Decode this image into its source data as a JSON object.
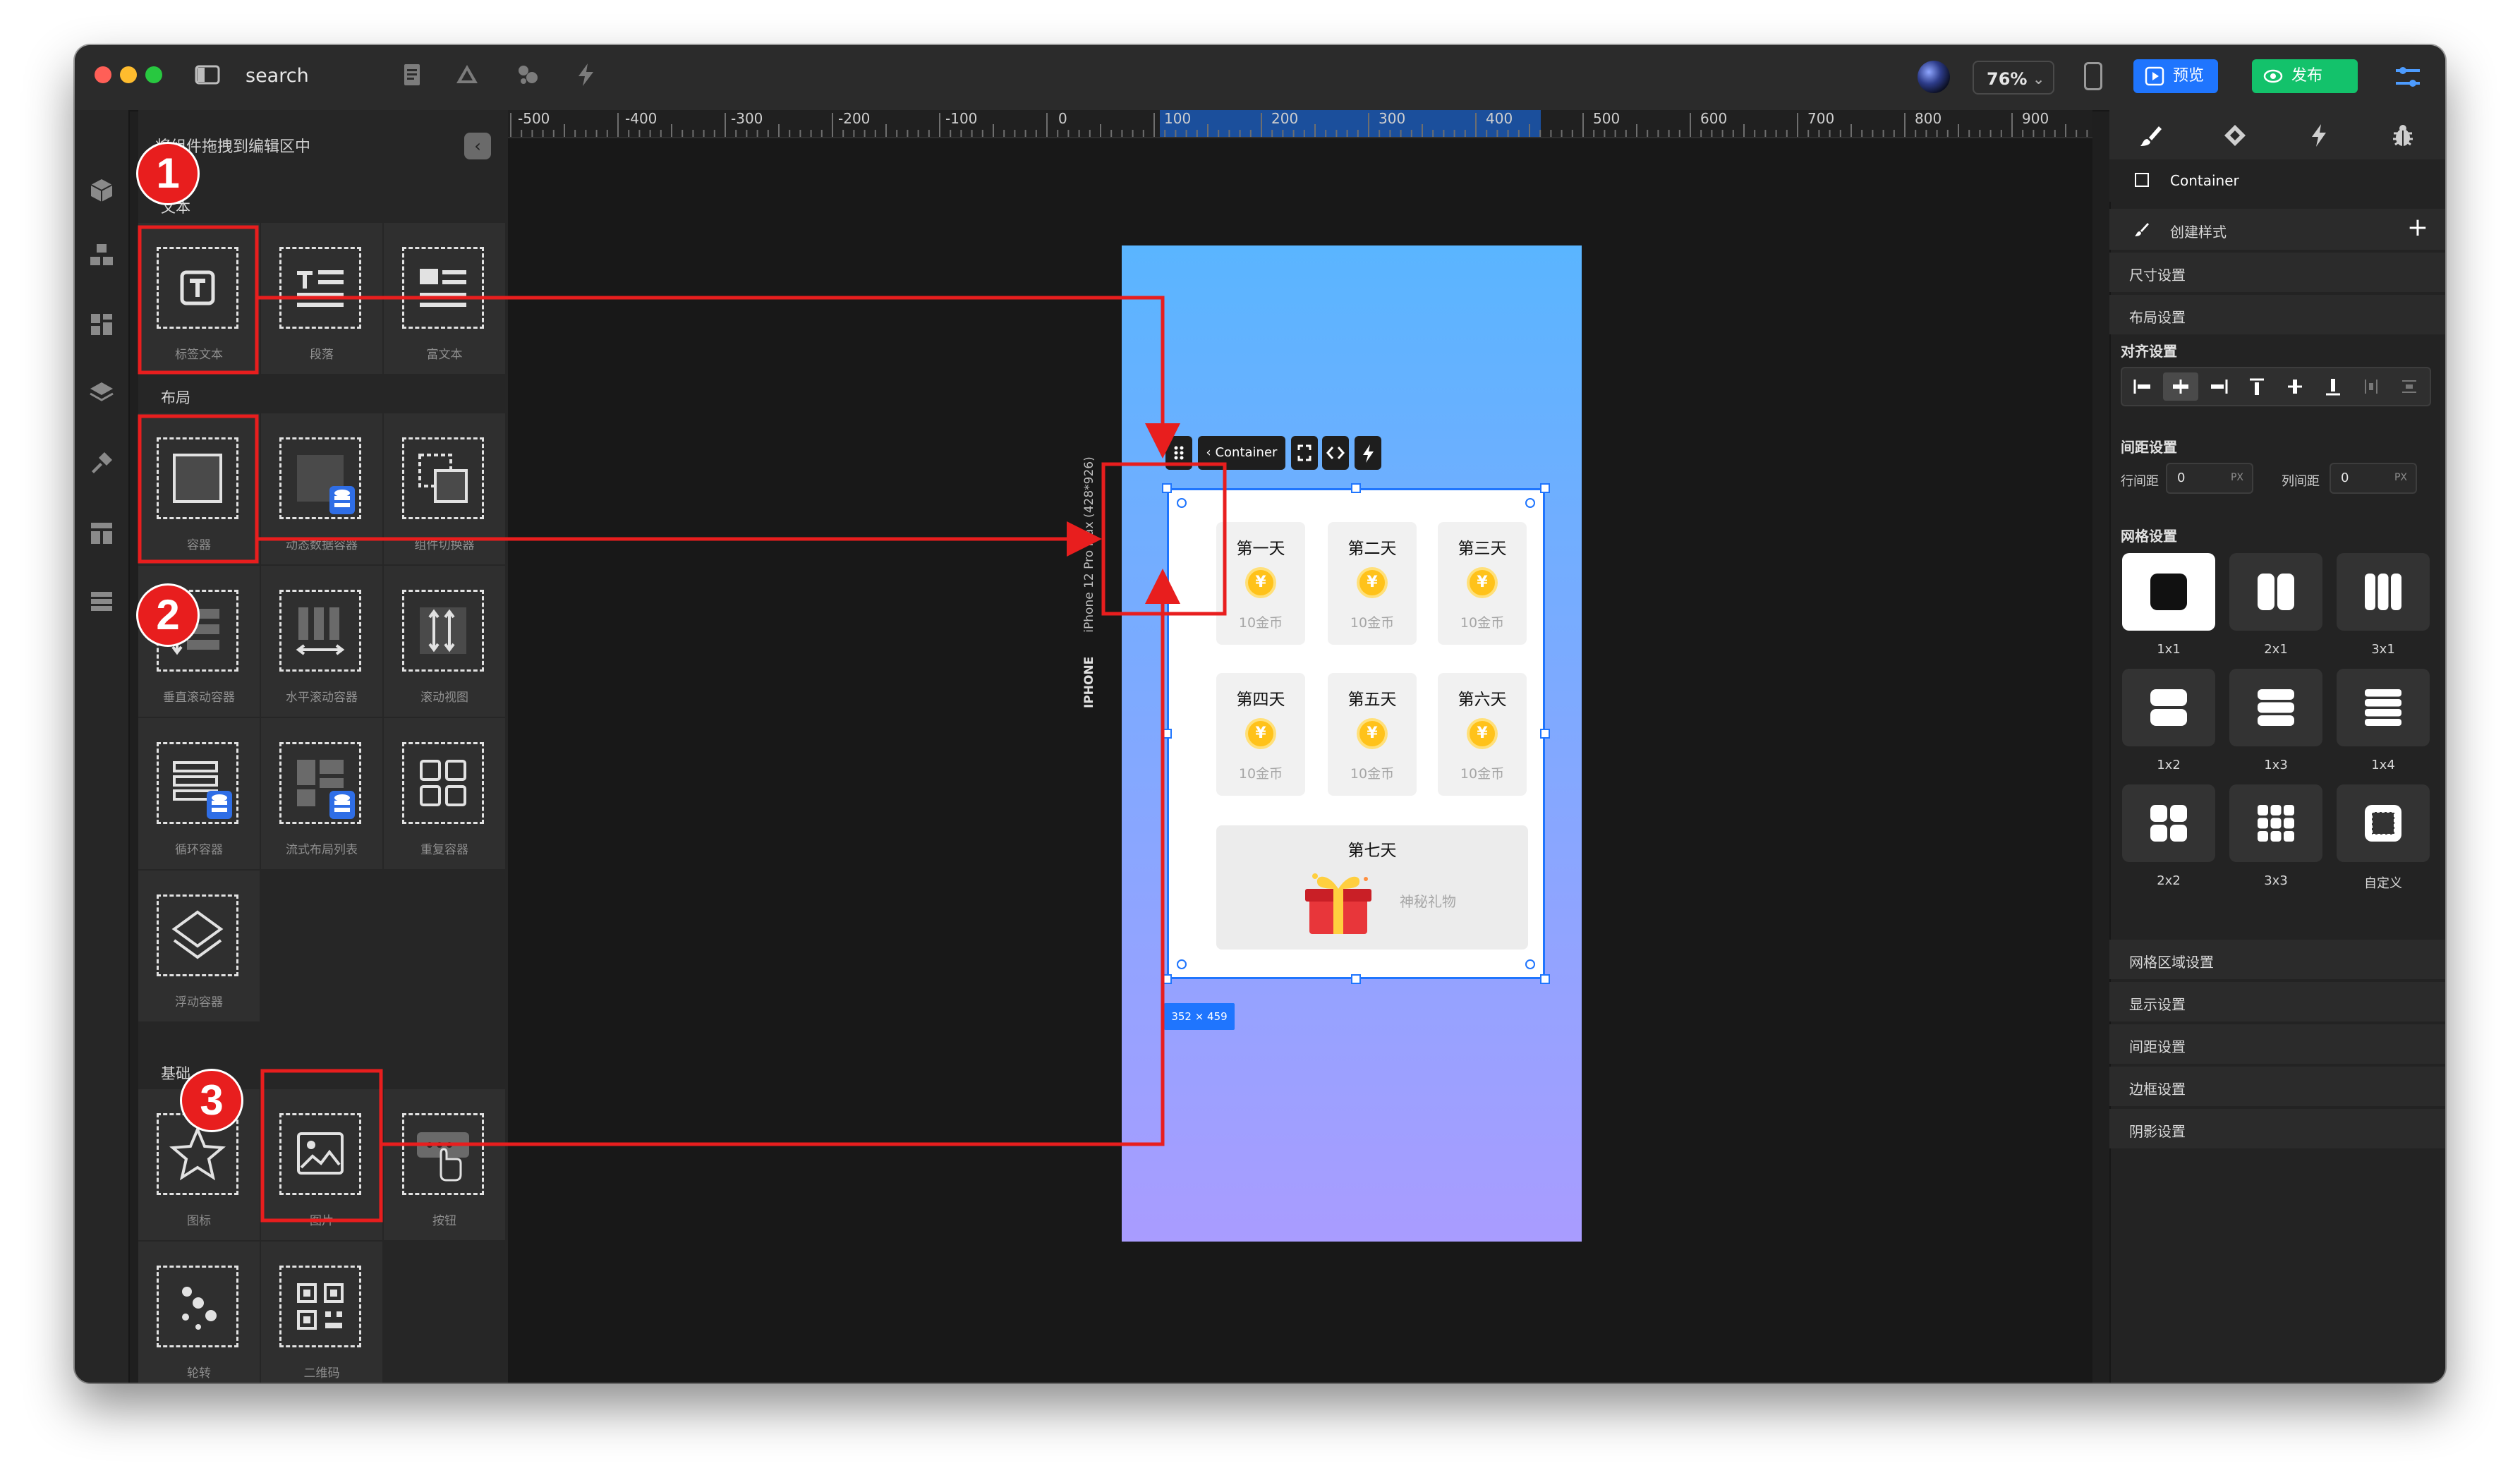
{
  "topbar": {
    "search_label": "search",
    "zoom": "76%",
    "preview_label": "预览",
    "publish_label": "发布"
  },
  "left_panel": {
    "hint": "将组件拖拽到编辑区中",
    "sections": {
      "text": "文本",
      "layout": "布局",
      "basic": "基础"
    },
    "text_items": [
      "标签文本",
      "段落",
      "富文本"
    ],
    "layout_items": [
      "容器",
      "动态数据容器",
      "组件切换器",
      "垂直滚动容器",
      "水平滚动容器",
      "滚动视图",
      "循环容器",
      "流式布局列表",
      "重复容器",
      "浮动容器"
    ],
    "basic_items": [
      "图标",
      "图片",
      "按钮",
      "轮转",
      "二维码"
    ]
  },
  "canvas": {
    "ruler_labels": [
      "-500",
      "-400",
      "-300",
      "-200",
      "-100",
      "0",
      "100",
      "200",
      "300",
      "400",
      "500",
      "600",
      "700",
      "800",
      "900"
    ],
    "device_type": "IPHONE",
    "device_model": "iPhone 12 Pro Max (428*926)",
    "selector_label": "Container",
    "size_badge": "352 × 459",
    "days": [
      {
        "title": "第一天",
        "value": "10金币"
      },
      {
        "title": "第二天",
        "value": "10金币"
      },
      {
        "title": "第三天",
        "value": "10金币"
      },
      {
        "title": "第四天",
        "value": "10金币"
      },
      {
        "title": "第五天",
        "value": "10金币"
      },
      {
        "title": "第六天",
        "value": "10金币"
      }
    ],
    "coin_symbol": "¥",
    "day7": {
      "title": "第七天",
      "value": "神秘礼物"
    }
  },
  "right_panel": {
    "element_name": "Container",
    "create_style": "创建样式",
    "size_settings": "尺寸设置",
    "layout_settings": "布局设置",
    "align_settings": "对齐设置",
    "spacing_settings": "间距设置",
    "row_gap_label": "行间距",
    "row_gap_value": "0",
    "col_gap_label": "列间距",
    "col_gap_value": "0",
    "unit": "PX",
    "grid_settings": "网格设置",
    "help": "?",
    "grid_options": [
      "1x1",
      "2x1",
      "3x1",
      "1x2",
      "1x3",
      "1x4",
      "2x2",
      "3x3",
      "自定义"
    ],
    "sections": [
      "网格区域设置",
      "显示设置",
      "间距设置",
      "边框设置",
      "阴影设置"
    ]
  },
  "annotations": {
    "steps": [
      "1",
      "2",
      "3"
    ],
    "color": "#e81e1e"
  },
  "colors": {
    "accent": "#1f75fe",
    "publish": "#13c26b",
    "phone_top": "#5ab5ff",
    "phone_bottom": "#a99cff",
    "coin": "#ffc21a"
  }
}
